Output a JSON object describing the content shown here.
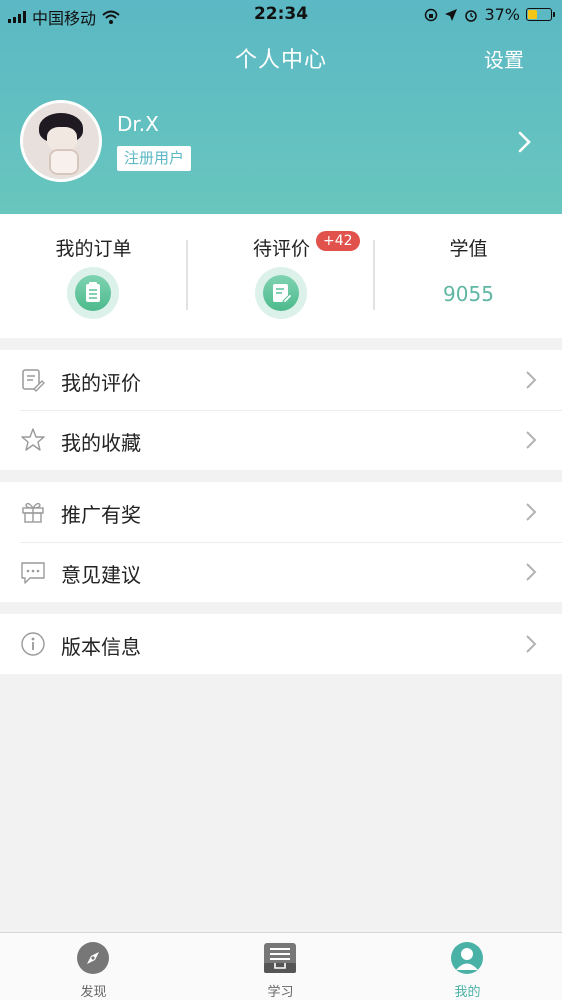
{
  "status_bar": {
    "carrier": "中国移动",
    "time": "22:34",
    "battery_percent": "37%",
    "battery_level": 0.37
  },
  "nav": {
    "title": "个人中心",
    "settings_label": "设置"
  },
  "profile": {
    "username": "Dr.X",
    "badge": "注册用户"
  },
  "stats": {
    "orders_label": "我的订单",
    "pending_label": "待评价",
    "pending_badge": "+42",
    "score_label": "学值",
    "score_value": "9055"
  },
  "menu_groups": [
    {
      "items": [
        {
          "label": "我的评价",
          "icon": "review-icon"
        },
        {
          "label": "我的收藏",
          "icon": "star-icon"
        }
      ]
    },
    {
      "items": [
        {
          "label": "推广有奖",
          "icon": "gift-icon"
        },
        {
          "label": "意见建议",
          "icon": "feedback-icon"
        }
      ]
    },
    {
      "items": [
        {
          "label": "版本信息",
          "icon": "info-icon"
        }
      ]
    }
  ],
  "tabs": [
    {
      "label": "发现",
      "icon": "compass-icon"
    },
    {
      "label": "学习",
      "icon": "book-icon"
    },
    {
      "label": "我的",
      "icon": "user-icon",
      "active": true
    }
  ],
  "colors": {
    "header_gradient_start": "#5bb8c4",
    "header_gradient_end": "#68c6be",
    "accent": "#49b1a5",
    "badge_red": "#e0524b",
    "background": "#f2f2f2"
  }
}
